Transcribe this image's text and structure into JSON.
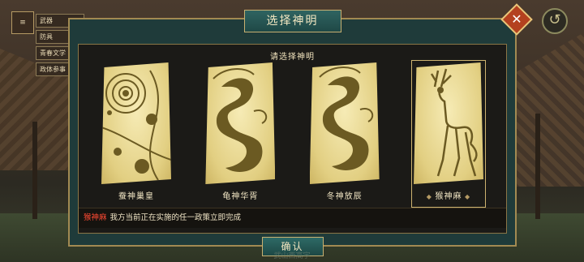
{
  "dialog": {
    "title": "选择神明",
    "prompt": "请选择神明",
    "confirm_label": "确认",
    "close_icon": "close-icon"
  },
  "cards": [
    {
      "name": "蚕神巢皇",
      "icon": "planets-icon",
      "selected": false
    },
    {
      "name": "龟神华胥",
      "icon": "dragon-icon",
      "selected": false
    },
    {
      "name": "冬神放辰",
      "icon": "dragon-icon",
      "selected": false
    },
    {
      "name": "猴神麻",
      "icon": "deer-icon",
      "selected": true
    }
  ],
  "description": {
    "name": "猴神麻",
    "text": "我方当前正在实施的任一政策立即完成"
  },
  "side_menu": {
    "items": [
      "武器",
      "防具",
      "青春文学",
      "政体参事"
    ]
  },
  "bottom_hint": "武山西高宇",
  "colors": {
    "dialog_frame": "#a28a52",
    "title_bg": "#2f6461",
    "close_bg": "#b4411f",
    "highlight_name": "#ff4a33",
    "card_bg": "#e2cf82"
  }
}
